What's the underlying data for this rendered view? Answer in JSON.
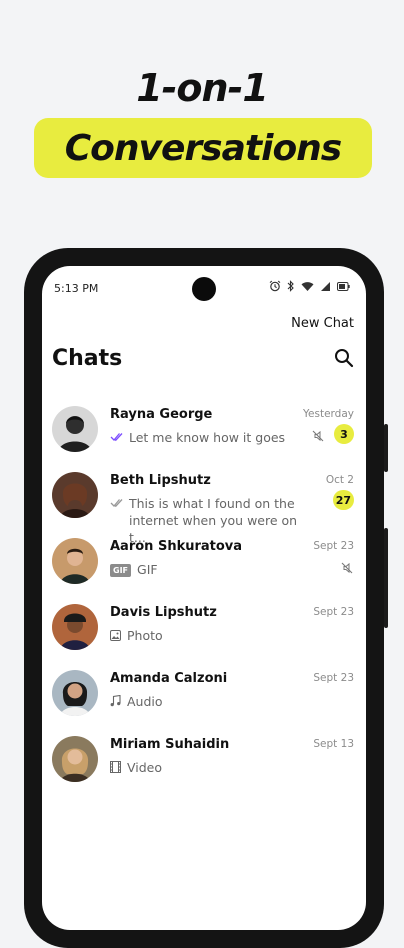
{
  "headline": "1-on-1",
  "highlight": "Conversations",
  "accent_color": "#e8ec3f",
  "status_bar": {
    "time": "5:13 PM",
    "icons": [
      "alarm-icon",
      "bluetooth-icon",
      "wifi-icon",
      "signal-icon",
      "battery-icon"
    ]
  },
  "header": {
    "new_chat_label": "New Chat",
    "title": "Chats",
    "search_icon": "search-icon"
  },
  "chats": [
    {
      "name": "Rayna George",
      "time": "Yesterday",
      "preview": "Let me know how it goes",
      "preview_icon": "double-check-icon",
      "muted": true,
      "unread": "3"
    },
    {
      "name": "Beth Lipshutz",
      "time": "Oct 2",
      "preview": "This is what I found on the internet when you were on t...",
      "preview_icon": "double-check-icon",
      "muted": false,
      "unread": "27"
    },
    {
      "name": "Aaron Shkuratova",
      "time": "Sept 23",
      "preview": "GIF",
      "preview_tag": "GIF",
      "preview_icon": "gif-icon",
      "muted": true,
      "unread": ""
    },
    {
      "name": "Davis Lipshutz",
      "time": "Sept 23",
      "preview": "Photo",
      "preview_icon": "photo-icon",
      "muted": false,
      "unread": ""
    },
    {
      "name": "Amanda Calzoni",
      "time": "Sept 23",
      "preview": "Audio",
      "preview_icon": "music-note-icon",
      "muted": false,
      "unread": ""
    },
    {
      "name": "Miriam Suhaidin",
      "time": "Sept 13",
      "preview": "Video",
      "preview_icon": "video-icon",
      "muted": false,
      "unread": ""
    }
  ]
}
